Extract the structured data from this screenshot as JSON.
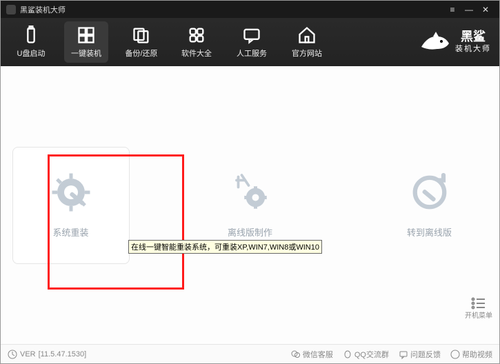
{
  "title": "黑鲨装机大师",
  "window_buttons": {
    "menu": "≡",
    "min": "—",
    "close": "✕"
  },
  "toolbar": {
    "items": [
      {
        "label": "U盘启动"
      },
      {
        "label": "一键装机"
      },
      {
        "label": "备份/还原"
      },
      {
        "label": "软件大全"
      },
      {
        "label": "人工服务"
      },
      {
        "label": "官方网站"
      }
    ]
  },
  "brand": {
    "name": "黑鲨",
    "sub": "装机大师"
  },
  "cards": {
    "reinstall": {
      "label": "系统重装"
    },
    "offline_make": {
      "label": "离线版制作"
    },
    "to_offline": {
      "label": "转到离线版"
    }
  },
  "tooltip": "在线一键智能重装系统，可重装XP,WIN7,WIN8或WIN10",
  "rightrail": {
    "label": "开机菜单"
  },
  "status": {
    "version_prefix": "VER",
    "version": "[11.5.47.1530]",
    "wechat": "微信客服",
    "qq": "QQ交流群",
    "feedback": "问题反馈",
    "help": "帮助视频"
  }
}
